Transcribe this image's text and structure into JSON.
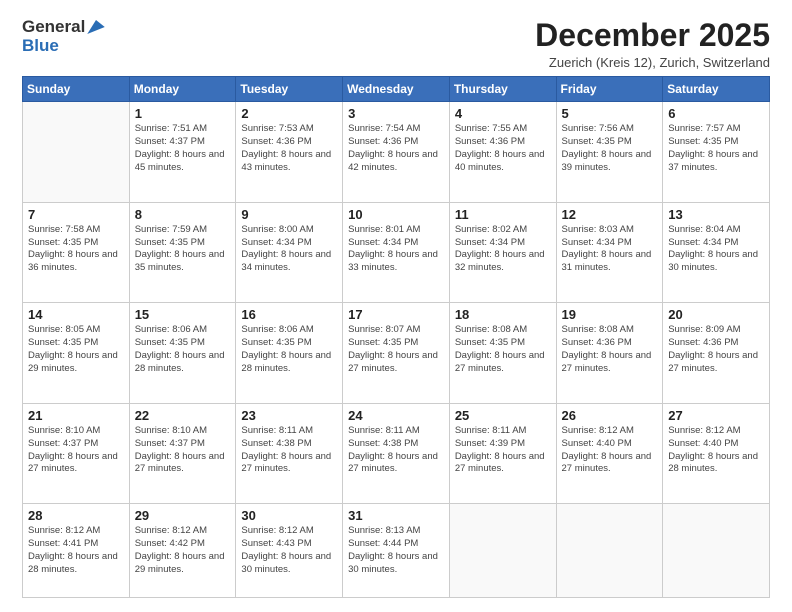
{
  "logo": {
    "general": "General",
    "blue": "Blue"
  },
  "header": {
    "month": "December 2025",
    "location": "Zuerich (Kreis 12), Zurich, Switzerland"
  },
  "weekdays": [
    "Sunday",
    "Monday",
    "Tuesday",
    "Wednesday",
    "Thursday",
    "Friday",
    "Saturday"
  ],
  "weeks": [
    [
      {
        "date": "",
        "sunrise": "",
        "sunset": "",
        "daylight": ""
      },
      {
        "date": "1",
        "sunrise": "Sunrise: 7:51 AM",
        "sunset": "Sunset: 4:37 PM",
        "daylight": "Daylight: 8 hours and 45 minutes."
      },
      {
        "date": "2",
        "sunrise": "Sunrise: 7:53 AM",
        "sunset": "Sunset: 4:36 PM",
        "daylight": "Daylight: 8 hours and 43 minutes."
      },
      {
        "date": "3",
        "sunrise": "Sunrise: 7:54 AM",
        "sunset": "Sunset: 4:36 PM",
        "daylight": "Daylight: 8 hours and 42 minutes."
      },
      {
        "date": "4",
        "sunrise": "Sunrise: 7:55 AM",
        "sunset": "Sunset: 4:36 PM",
        "daylight": "Daylight: 8 hours and 40 minutes."
      },
      {
        "date": "5",
        "sunrise": "Sunrise: 7:56 AM",
        "sunset": "Sunset: 4:35 PM",
        "daylight": "Daylight: 8 hours and 39 minutes."
      },
      {
        "date": "6",
        "sunrise": "Sunrise: 7:57 AM",
        "sunset": "Sunset: 4:35 PM",
        "daylight": "Daylight: 8 hours and 37 minutes."
      }
    ],
    [
      {
        "date": "7",
        "sunrise": "Sunrise: 7:58 AM",
        "sunset": "Sunset: 4:35 PM",
        "daylight": "Daylight: 8 hours and 36 minutes."
      },
      {
        "date": "8",
        "sunrise": "Sunrise: 7:59 AM",
        "sunset": "Sunset: 4:35 PM",
        "daylight": "Daylight: 8 hours and 35 minutes."
      },
      {
        "date": "9",
        "sunrise": "Sunrise: 8:00 AM",
        "sunset": "Sunset: 4:34 PM",
        "daylight": "Daylight: 8 hours and 34 minutes."
      },
      {
        "date": "10",
        "sunrise": "Sunrise: 8:01 AM",
        "sunset": "Sunset: 4:34 PM",
        "daylight": "Daylight: 8 hours and 33 minutes."
      },
      {
        "date": "11",
        "sunrise": "Sunrise: 8:02 AM",
        "sunset": "Sunset: 4:34 PM",
        "daylight": "Daylight: 8 hours and 32 minutes."
      },
      {
        "date": "12",
        "sunrise": "Sunrise: 8:03 AM",
        "sunset": "Sunset: 4:34 PM",
        "daylight": "Daylight: 8 hours and 31 minutes."
      },
      {
        "date": "13",
        "sunrise": "Sunrise: 8:04 AM",
        "sunset": "Sunset: 4:34 PM",
        "daylight": "Daylight: 8 hours and 30 minutes."
      }
    ],
    [
      {
        "date": "14",
        "sunrise": "Sunrise: 8:05 AM",
        "sunset": "Sunset: 4:35 PM",
        "daylight": "Daylight: 8 hours and 29 minutes."
      },
      {
        "date": "15",
        "sunrise": "Sunrise: 8:06 AM",
        "sunset": "Sunset: 4:35 PM",
        "daylight": "Daylight: 8 hours and 28 minutes."
      },
      {
        "date": "16",
        "sunrise": "Sunrise: 8:06 AM",
        "sunset": "Sunset: 4:35 PM",
        "daylight": "Daylight: 8 hours and 28 minutes."
      },
      {
        "date": "17",
        "sunrise": "Sunrise: 8:07 AM",
        "sunset": "Sunset: 4:35 PM",
        "daylight": "Daylight: 8 hours and 27 minutes."
      },
      {
        "date": "18",
        "sunrise": "Sunrise: 8:08 AM",
        "sunset": "Sunset: 4:35 PM",
        "daylight": "Daylight: 8 hours and 27 minutes."
      },
      {
        "date": "19",
        "sunrise": "Sunrise: 8:08 AM",
        "sunset": "Sunset: 4:36 PM",
        "daylight": "Daylight: 8 hours and 27 minutes."
      },
      {
        "date": "20",
        "sunrise": "Sunrise: 8:09 AM",
        "sunset": "Sunset: 4:36 PM",
        "daylight": "Daylight: 8 hours and 27 minutes."
      }
    ],
    [
      {
        "date": "21",
        "sunrise": "Sunrise: 8:10 AM",
        "sunset": "Sunset: 4:37 PM",
        "daylight": "Daylight: 8 hours and 27 minutes."
      },
      {
        "date": "22",
        "sunrise": "Sunrise: 8:10 AM",
        "sunset": "Sunset: 4:37 PM",
        "daylight": "Daylight: 8 hours and 27 minutes."
      },
      {
        "date": "23",
        "sunrise": "Sunrise: 8:11 AM",
        "sunset": "Sunset: 4:38 PM",
        "daylight": "Daylight: 8 hours and 27 minutes."
      },
      {
        "date": "24",
        "sunrise": "Sunrise: 8:11 AM",
        "sunset": "Sunset: 4:38 PM",
        "daylight": "Daylight: 8 hours and 27 minutes."
      },
      {
        "date": "25",
        "sunrise": "Sunrise: 8:11 AM",
        "sunset": "Sunset: 4:39 PM",
        "daylight": "Daylight: 8 hours and 27 minutes."
      },
      {
        "date": "26",
        "sunrise": "Sunrise: 8:12 AM",
        "sunset": "Sunset: 4:40 PM",
        "daylight": "Daylight: 8 hours and 27 minutes."
      },
      {
        "date": "27",
        "sunrise": "Sunrise: 8:12 AM",
        "sunset": "Sunset: 4:40 PM",
        "daylight": "Daylight: 8 hours and 28 minutes."
      }
    ],
    [
      {
        "date": "28",
        "sunrise": "Sunrise: 8:12 AM",
        "sunset": "Sunset: 4:41 PM",
        "daylight": "Daylight: 8 hours and 28 minutes."
      },
      {
        "date": "29",
        "sunrise": "Sunrise: 8:12 AM",
        "sunset": "Sunset: 4:42 PM",
        "daylight": "Daylight: 8 hours and 29 minutes."
      },
      {
        "date": "30",
        "sunrise": "Sunrise: 8:12 AM",
        "sunset": "Sunset: 4:43 PM",
        "daylight": "Daylight: 8 hours and 30 minutes."
      },
      {
        "date": "31",
        "sunrise": "Sunrise: 8:13 AM",
        "sunset": "Sunset: 4:44 PM",
        "daylight": "Daylight: 8 hours and 30 minutes."
      },
      {
        "date": "",
        "sunrise": "",
        "sunset": "",
        "daylight": ""
      },
      {
        "date": "",
        "sunrise": "",
        "sunset": "",
        "daylight": ""
      },
      {
        "date": "",
        "sunrise": "",
        "sunset": "",
        "daylight": ""
      }
    ]
  ]
}
